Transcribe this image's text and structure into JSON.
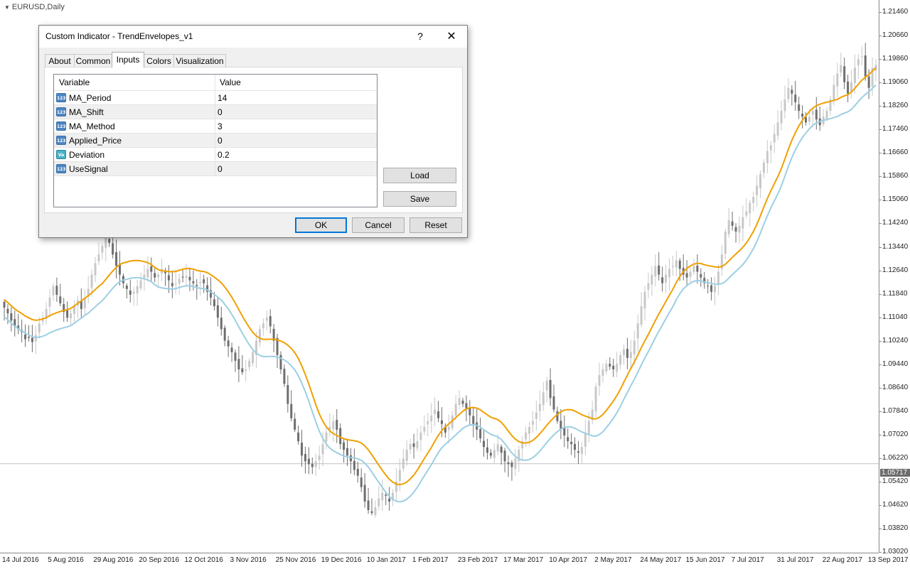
{
  "chart": {
    "symbol": "EURUSD,Daily",
    "current_price": "1.05717",
    "price_ticks": [
      "1.21460",
      "1.20660",
      "1.19860",
      "1.19060",
      "1.18260",
      "1.17460",
      "1.16660",
      "1.15860",
      "1.15060",
      "1.14240",
      "1.13440",
      "1.12640",
      "1.11840",
      "1.11040",
      "1.10240",
      "1.09440",
      "1.08640",
      "1.07840",
      "1.07020",
      "1.06220",
      "1.05420",
      "1.04620",
      "1.03820",
      "1.03020"
    ],
    "time_ticks": [
      "14 Jul 2016",
      "5 Aug 2016",
      "29 Aug 2016",
      "20 Sep 2016",
      "12 Oct 2016",
      "3 Nov 2016",
      "25 Nov 2016",
      "19 Dec 2016",
      "10 Jan 2017",
      "1 Feb 2017",
      "23 Feb 2017",
      "17 Mar 2017",
      "10 Apr 2017",
      "2 May 2017",
      "24 May 2017",
      "15 Jun 2017",
      "7 Jul 2017",
      "31 Jul 2017",
      "22 Aug 2017",
      "13 Sep 2017"
    ],
    "colors": {
      "candle_bull": "#c8c8c8",
      "candle_bear": "#6e6e6e",
      "upper_line": "#f0a000",
      "lower_line": "#9ccfe3",
      "price_line": "#c0c0c0"
    },
    "closes": [
      1.1115,
      1.1095,
      1.107,
      1.105,
      1.104,
      1.103,
      1.1005,
      1.101,
      1.0995,
      1.102,
      1.106,
      1.108,
      1.111,
      1.115,
      1.119,
      1.116,
      1.113,
      1.11,
      1.108,
      1.1095,
      1.112,
      1.114,
      1.111,
      1.115,
      1.118,
      1.123,
      1.127,
      1.13,
      1.133,
      1.136,
      1.134,
      1.13,
      1.126,
      1.123,
      1.12,
      1.118,
      1.116,
      1.117,
      1.119,
      1.121,
      1.123,
      1.125,
      1.124,
      1.122,
      1.123,
      1.125,
      1.1235,
      1.121,
      1.119,
      1.12,
      1.1215,
      1.122,
      1.1225,
      1.121,
      1.12,
      1.119,
      1.1205,
      1.12,
      1.117,
      1.115,
      1.112,
      1.108,
      1.104,
      1.1,
      1.098,
      1.096,
      1.093,
      1.09,
      1.089,
      1.09,
      1.093,
      1.096,
      1.1,
      1.104,
      1.106,
      1.108,
      1.105,
      1.1,
      1.095,
      1.09,
      1.085,
      1.078,
      1.073,
      1.069,
      1.065,
      1.06,
      1.058,
      1.057,
      1.056,
      1.058,
      1.06,
      1.064,
      1.068,
      1.07,
      1.072,
      1.069,
      1.064,
      1.062,
      1.06,
      1.058,
      1.055,
      1.053,
      1.049,
      1.044,
      1.041,
      1.04,
      1.042,
      1.045,
      1.047,
      1.046,
      1.044,
      1.047,
      1.051,
      1.055,
      1.059,
      1.062,
      1.064,
      1.063,
      1.065,
      1.068,
      1.07,
      1.072,
      1.074,
      1.076,
      1.073,
      1.071,
      1.068,
      1.07,
      1.074,
      1.078,
      1.08,
      1.078,
      1.076,
      1.074,
      1.071,
      1.069,
      1.066,
      1.063,
      1.061,
      1.06,
      1.062,
      1.064,
      1.061,
      1.058,
      1.057,
      1.056,
      1.059,
      1.062,
      1.065,
      1.068,
      1.07,
      1.072,
      1.075,
      1.078,
      1.082,
      1.086,
      1.08,
      1.076,
      1.072,
      1.069,
      1.067,
      1.065,
      1.064,
      1.062,
      1.061,
      1.063,
      1.068,
      1.072,
      1.076,
      1.084,
      1.088,
      1.09,
      1.092,
      1.091,
      1.09,
      1.092,
      1.095,
      1.097,
      1.094,
      1.096,
      1.1,
      1.106,
      1.112,
      1.117,
      1.12,
      1.123,
      1.126,
      1.123,
      1.12,
      1.123,
      1.125,
      1.126,
      1.128,
      1.125,
      1.123,
      1.122,
      1.124,
      1.126,
      1.124,
      1.122,
      1.12,
      1.119,
      1.117,
      1.119,
      1.124,
      1.13,
      1.138,
      1.142,
      1.14,
      1.138,
      1.14,
      1.143,
      1.145,
      1.148,
      1.15,
      1.154,
      1.158,
      1.162,
      1.166,
      1.168,
      1.172,
      1.176,
      1.18,
      1.184,
      1.188,
      1.186,
      1.183,
      1.18,
      1.178,
      1.176,
      1.178,
      1.18,
      1.177,
      1.175,
      1.178,
      1.18,
      1.184,
      1.189,
      1.193,
      1.196,
      1.19,
      1.186,
      1.19,
      1.195,
      1.198,
      1.199,
      1.192,
      1.188,
      1.195,
      1.196
    ]
  },
  "dialog": {
    "title": "Custom Indicator - TrendEnvelopes_v1",
    "help_symbol": "?",
    "close_symbol": "✕",
    "tabs": [
      "About",
      "Common",
      "Inputs",
      "Colors",
      "Visualization"
    ],
    "active_tab": "Inputs",
    "grid": {
      "header_variable": "Variable",
      "header_value": "Value",
      "rows": [
        {
          "icon": "123",
          "variable": "MA_Period",
          "value": "14"
        },
        {
          "icon": "123",
          "variable": "MA_Shift",
          "value": "0"
        },
        {
          "icon": "123",
          "variable": "MA_Method",
          "value": "3"
        },
        {
          "icon": "123",
          "variable": "Applied_Price",
          "value": "0"
        },
        {
          "icon": "Va",
          "variable": "Deviation",
          "value": "0.2"
        },
        {
          "icon": "123",
          "variable": "UseSignal",
          "value": "0"
        }
      ]
    },
    "load_label": "Load",
    "save_label": "Save",
    "ok_label": "OK",
    "cancel_label": "Cancel",
    "reset_label": "Reset"
  }
}
